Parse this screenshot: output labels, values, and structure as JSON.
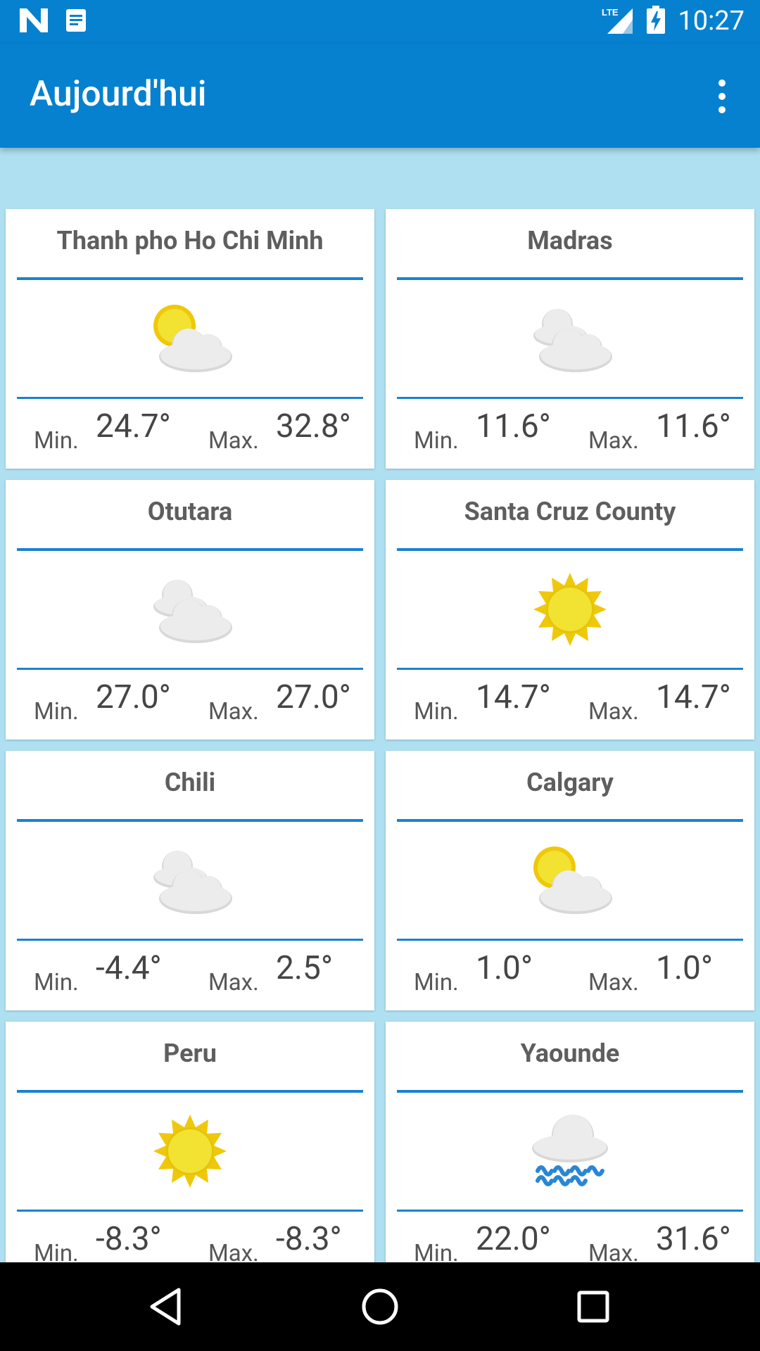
{
  "status_bar": {
    "time": "10:27",
    "network_label": "LTE"
  },
  "app_bar": {
    "title": "Aujourd'hui"
  },
  "labels": {
    "min": "Min.",
    "max": "Max."
  },
  "cities": [
    {
      "name": "Thanh pho Ho Chi Minh",
      "icon": "partly-cloudy-icon",
      "min": "24.7°",
      "max": "32.8°"
    },
    {
      "name": "Madras",
      "icon": "cloudy-icon",
      "min": "11.6°",
      "max": "11.6°"
    },
    {
      "name": "Otutara",
      "icon": "cloudy-icon",
      "min": "27.0°",
      "max": "27.0°"
    },
    {
      "name": "Santa Cruz County",
      "icon": "sunny-icon",
      "min": "14.7°",
      "max": "14.7°"
    },
    {
      "name": "Chili",
      "icon": "cloudy-icon",
      "min": "-4.4°",
      "max": "2.5°"
    },
    {
      "name": "Calgary",
      "icon": "partly-cloudy-icon",
      "min": "1.0°",
      "max": "1.0°"
    },
    {
      "name": "Peru",
      "icon": "sunny-icon",
      "min": "-8.3°",
      "max": "-8.3°"
    },
    {
      "name": "Yaounde",
      "icon": "rain-icon",
      "min": "22.0°",
      "max": "31.6°"
    }
  ],
  "colors": {
    "primary": "#0681cf",
    "background": "#aee0f2",
    "divider": "#1a82d0",
    "sun": "#f2e232",
    "sun_rays": "#f0c80a",
    "cloud": "#e4e4e4",
    "rain": "#2a86d4"
  },
  "navigation": {
    "back": "back-icon",
    "home": "home-icon",
    "recents": "recents-icon"
  }
}
